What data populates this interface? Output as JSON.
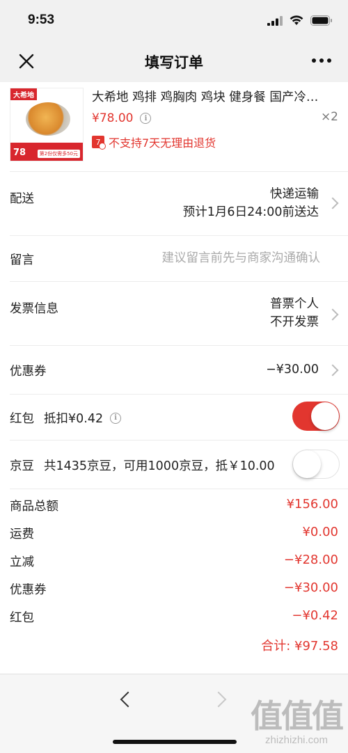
{
  "status_bar": {
    "time": "9:53"
  },
  "header": {
    "title": "填写订单"
  },
  "product": {
    "thumb_brand": "大希地",
    "thumb_price": "78",
    "thumb_promo": "第2份仅需多50元",
    "title": "大希地 鸡排 鸡胸肉 鸡块 健身餐 国产冷…",
    "price": "¥78.00",
    "quantity": "×2",
    "return_policy": "不支持7天无理由退货",
    "return_badge": "7"
  },
  "delivery": {
    "label": "配送",
    "method": "快递运输",
    "eta": "预计1月6日24:00前送达"
  },
  "message": {
    "label": "留言",
    "placeholder": "建议留言前先与商家沟通确认"
  },
  "invoice": {
    "label": "发票信息",
    "line1": "普票个人",
    "line2": "不开发票"
  },
  "coupon": {
    "label": "优惠券",
    "value": "−¥30.00"
  },
  "red_packet": {
    "label": "红包",
    "detail": "抵扣¥0.42",
    "enabled": true
  },
  "jd_beans": {
    "label": "京豆",
    "detail": "共1435京豆，可用1000京豆，抵￥10.00",
    "enabled": false
  },
  "summary": {
    "items": [
      {
        "label": "商品总额",
        "value": "¥156.00"
      },
      {
        "label": "运费",
        "value": "¥0.00"
      },
      {
        "label": "立减",
        "value": "−¥28.00"
      },
      {
        "label": "优惠券",
        "value": "−¥30.00"
      },
      {
        "label": "红包",
        "value": "−¥0.42"
      }
    ],
    "total": "合计: ¥97.58"
  },
  "colors": {
    "accent": "#e2362f",
    "header_bg": "#f1f1f1"
  },
  "watermark": {
    "text": "值值值",
    "url": "zhizhizhi.com"
  }
}
